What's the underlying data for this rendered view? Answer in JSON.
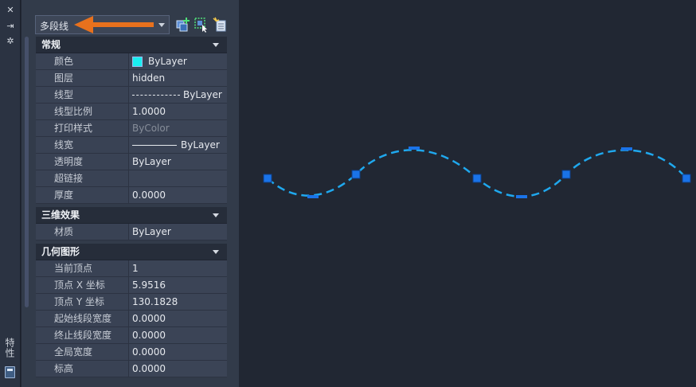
{
  "panel": {
    "title": "特性",
    "selector_value": "多段线",
    "categories": [
      {
        "name": "常规",
        "rows": [
          {
            "key": "颜色",
            "value": "ByLayer"
          },
          {
            "key": "图层",
            "value": "hidden"
          },
          {
            "key": "线型",
            "value": "ByLayer"
          },
          {
            "key": "线型比例",
            "value": "1.0000"
          },
          {
            "key": "打印样式",
            "value": "ByColor"
          },
          {
            "key": "线宽",
            "value": "ByLayer"
          },
          {
            "key": "透明度",
            "value": "ByLayer"
          },
          {
            "key": "超链接",
            "value": ""
          },
          {
            "key": "厚度",
            "value": "0.0000"
          }
        ]
      },
      {
        "name": "三维效果",
        "rows": [
          {
            "key": "材质",
            "value": "ByLayer"
          }
        ]
      },
      {
        "name": "几何图形",
        "rows": [
          {
            "key": "当前顶点",
            "value": "1"
          },
          {
            "key": "顶点 X 坐标",
            "value": "5.9516"
          },
          {
            "key": "顶点 Y 坐标",
            "value": "130.1828"
          },
          {
            "key": "起始线段宽度",
            "value": "0.0000"
          },
          {
            "key": "终止线段宽度",
            "value": "0.0000"
          },
          {
            "key": "全局宽度",
            "value": "0.0000"
          },
          {
            "key": "标高",
            "value": "0.0000"
          }
        ]
      }
    ]
  },
  "colors": {
    "color_swatch": "#19eef0",
    "polyline": "#1fa8ee",
    "grip": "#1a73e8",
    "annotation_arrow": "#e8711d",
    "canvas_bg": "#212733"
  },
  "icons": {
    "close": "close-icon",
    "autohide": "autohide-icon",
    "settings": "settings-icon",
    "toggle_pickadd": "toggle-pickadd-icon",
    "select_objects": "select-objects-icon",
    "quick_select": "quick-select-icon"
  }
}
